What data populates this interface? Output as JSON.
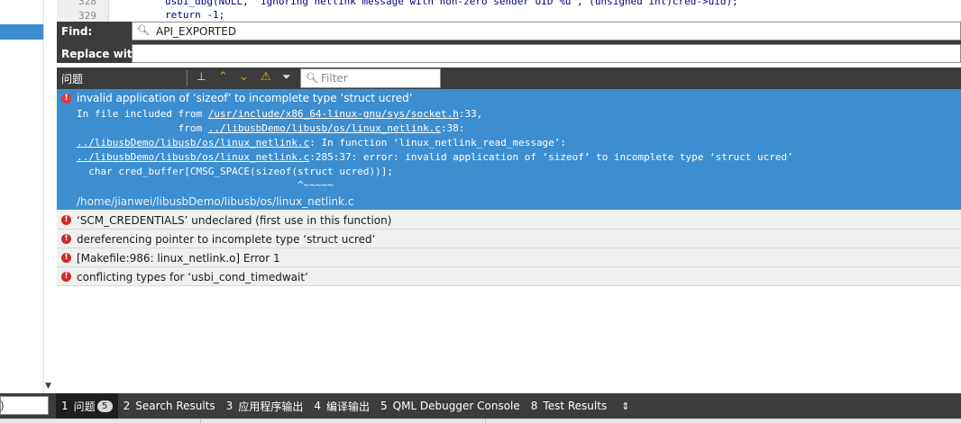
{
  "code": {
    "lines": [
      {
        "num": "328",
        "text": "usbi_dbg(NULL, \"ignoring netlink message with non-zero sender UID %u\", (unsigned int)cred->uid);"
      },
      {
        "num": "329",
        "text": "return -1;"
      }
    ]
  },
  "find": {
    "find_label": "Find:",
    "find_value": "API_EXPORTED",
    "replace_label": "Replace with:",
    "replace_value": ""
  },
  "issues": {
    "title": "问题",
    "filter_placeholder": "Filter",
    "selected": {
      "message": "invalid application of ‘sizeof’ to incomplete type ‘struct ucred’",
      "d1_prefix": "In file included from ",
      "d1_link": "/usr/include/x86_64-linux-gnu/sys/socket.h",
      "d1_suffix": ":33,",
      "d2_prefix": "                 from ",
      "d2_link": "../libusbDemo/libusb/os/linux_netlink.c",
      "d2_suffix": ":38:",
      "d3_link": "../libusbDemo/libusb/os/linux_netlink.c",
      "d3_suffix": ": In function ‘linux_netlink_read_message’:",
      "d4_link": "../libusbDemo/libusb/os/linux_netlink.c",
      "d4_suffix": ":285:37: error: invalid application of ‘sizeof’ to incomplete type ‘struct ucred’",
      "d5": "  char cred_buffer[CMSG_SPACE(sizeof(struct ucred))];",
      "d6": "                                     ^~~~~~",
      "path": "/home/jianwei/libusbDemo/libusb/os/linux_netlink.c"
    },
    "rows": [
      {
        "message": "‘SCM_CREDENTIALS’ undeclared (first use in this function)"
      },
      {
        "message": "dereferencing pointer to incomplete type ‘struct ucred’"
      },
      {
        "message": "[Makefile:986: linux_netlink.o] Error 1"
      },
      {
        "message": "conflicting types for ‘usbi_cond_timedwait’"
      }
    ]
  },
  "bottom": {
    "left_input_text": ")",
    "tabs": [
      {
        "num": "1",
        "label": "问题",
        "badge": "5"
      },
      {
        "num": "2",
        "label": "Search Results"
      },
      {
        "num": "3",
        "label": "应用程序输出"
      },
      {
        "num": "4",
        "label": "编译输出"
      },
      {
        "num": "5",
        "label": "QML Debugger Console"
      },
      {
        "num": "8",
        "label": "Test Results"
      }
    ],
    "updown_symbol": "⇕"
  },
  "colors": {
    "accent": "#3d8ed0",
    "panel_dark": "#3c3c3c",
    "error": "#d02828",
    "warning": "#e8b400",
    "toolbar_arrow": "#e8a000"
  }
}
